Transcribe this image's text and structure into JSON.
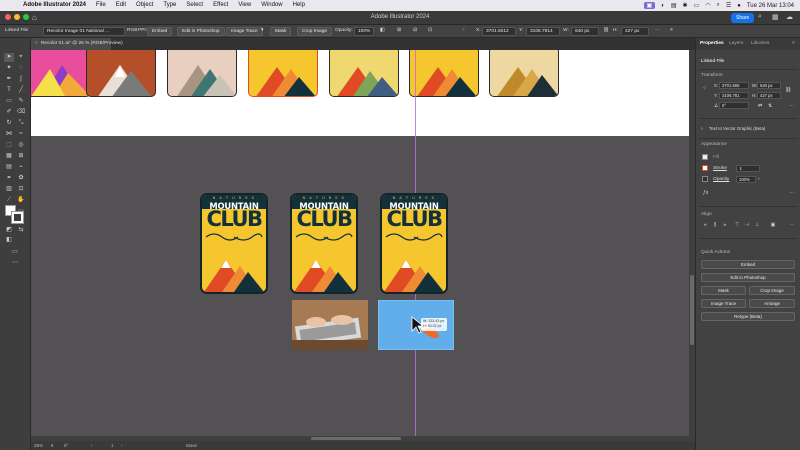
{
  "menubar": {
    "apple": "",
    "app": "Adobe Illustrator 2024",
    "items": [
      "File",
      "Edit",
      "Object",
      "Type",
      "Select",
      "Effect",
      "View",
      "Window",
      "Help"
    ],
    "datetime": "Tue 26 Mar  13:04"
  },
  "titlebar": {
    "title": "Adobe Illustrator 2024",
    "share": "Share"
  },
  "controlbar": {
    "linked_file": "Linked File",
    "filename": "Recolor Image 01 National ...",
    "mode": "RGB",
    "ppi": "PPI: 72",
    "embed": "Embed",
    "edit_photoshop": "Edit in Photoshop",
    "image_trace": "Image Trace",
    "mask": "Mask",
    "crop_image": "Crop Image",
    "opacity_label": "Opacity:",
    "opacity_value": "100%",
    "x_label": "X:",
    "x_value": "3701.5012 p",
    "y_label": "Y:",
    "y_value": "3106.7814 p",
    "w_label": "W:",
    "w_value": "640 px",
    "h_label": "H:",
    "h_value": "427 px"
  },
  "document_tab": {
    "close": "×",
    "label": "Recolor 01.ai* @ 25 % (RGB/Preview)"
  },
  "badges": {
    "small_text": "N A T U R E S",
    "mountain": "MOUNTAIN",
    "club": "CLUB"
  },
  "cursor_tooltip": {
    "line1": "W: 333.43 px",
    "line2": "H: 50.02 px"
  },
  "status": {
    "zoom": "25%",
    "rotate": "0°",
    "artboard": "1",
    "tool": "Move"
  },
  "panel": {
    "tabs": [
      "Properties",
      "Layers",
      "Libraries"
    ],
    "linked_file": "Linked File",
    "transform": "Transform",
    "x_label": "X:",
    "x_value": "3701.565",
    "y_label": "Y:",
    "y_value": "3106.781",
    "w_label": "W:",
    "w_value": "640 px",
    "h_label": "H:",
    "h_value": "427 px",
    "angle": "0°",
    "text_to_vector": "Text to Vector Graphic (Beta)",
    "appearance": "Appearance",
    "fill": "Fill",
    "stroke": "Stroke",
    "opacity": "Opacity",
    "opacity_value": "100%",
    "align": "Align",
    "quick_actions": "Quick Actions",
    "embed": "Embed",
    "edit_photoshop": "Edit in Photoshop",
    "mask": "Mask",
    "crop_image": "Crop Image",
    "image_trace": "Image Trace",
    "arrange": "Arrange",
    "retype": "Retype (Beta)"
  },
  "colors": {
    "canvas": "#535153",
    "badge_yellow": "#f5c62d",
    "badge_navy": "#13313a",
    "guide": "#c36ad8",
    "accent": "#1473e6"
  }
}
